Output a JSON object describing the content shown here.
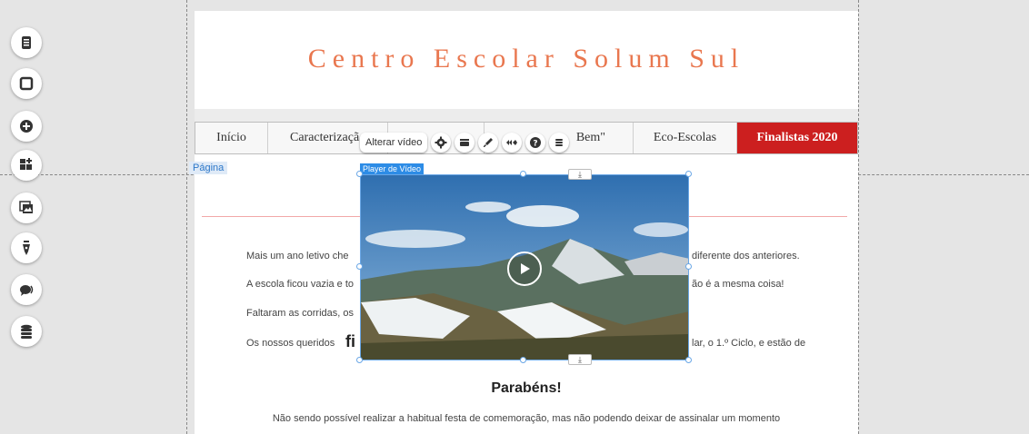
{
  "site": {
    "title": "Centro Escolar Solum Sul"
  },
  "menu": {
    "items": [
      "Início",
      "Caracterizaçã",
      "",
      "Bem\"",
      "Eco-Escolas",
      "Finalistas 2020"
    ]
  },
  "labels": {
    "page": "Página",
    "video_player": "Player de Vídeo",
    "alter_video": "Alterar vídeo"
  },
  "content": {
    "line1_left": "Mais um ano letivo che",
    "line1_right": "diferente dos anteriores.",
    "line2_left": "A escola ficou vazia e to",
    "line2_right": "ão é a mesma coisa!",
    "line3_left": "Faltaram as corridas, os",
    "line4_left": "Os nossos queridos",
    "line4_bold": "fi",
    "line4_right": "lar, o 1.º Ciclo, e estão de",
    "congrats": "Parabéns!",
    "line5": "Não sendo possível realizar a habitual festa de comemoração, mas não podendo deixar de assinalar um momento"
  },
  "icons": {
    "rail": [
      "page-icon",
      "square-icon",
      "plus-circle-icon",
      "add-widget-icon",
      "gallery-icon",
      "pen-icon",
      "chat-icon",
      "database-icon"
    ],
    "toolbar": [
      "gear-icon",
      "layout-icon",
      "brush-icon",
      "animation-icon",
      "help-icon",
      "stack-icon"
    ]
  },
  "colors": {
    "title": "#e9774f",
    "active_menu": "#cc1f1f",
    "selection": "#2d8ce6"
  }
}
